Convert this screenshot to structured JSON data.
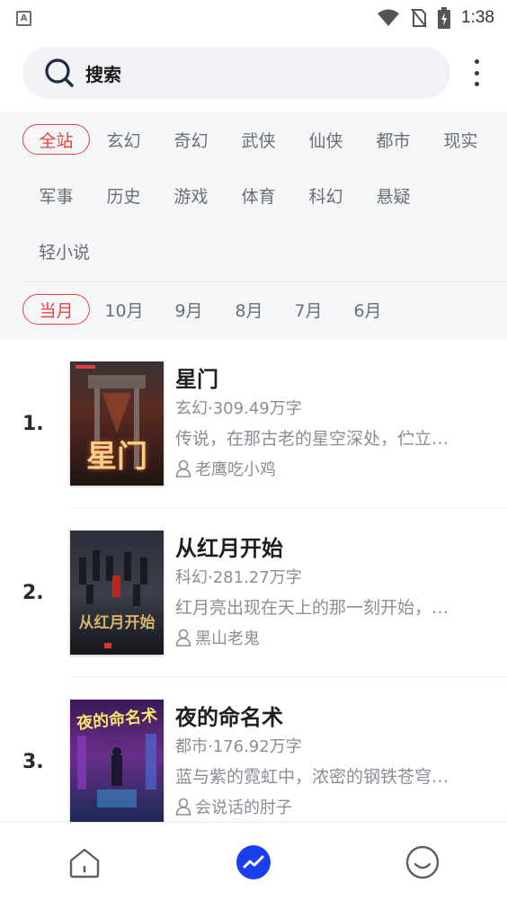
{
  "status_bar": {
    "left_icon": "A",
    "time": "1:38",
    "icons": [
      "wifi-icon",
      "no-sim-icon",
      "battery-charging-icon"
    ]
  },
  "search": {
    "label": "搜索",
    "icon": "search-icon"
  },
  "categories": [
    "全站",
    "玄幻",
    "奇幻",
    "武侠",
    "仙侠",
    "都市",
    "现实",
    "军事",
    "历史",
    "游戏",
    "体育",
    "科幻",
    "悬疑",
    "轻小说"
  ],
  "selected_category": "全站",
  "months": [
    "当月",
    "10月",
    "9月",
    "8月",
    "7月",
    "6月"
  ],
  "selected_month": "当月",
  "books": [
    {
      "rank": "1.",
      "title": "星门",
      "meta": "玄幻·309.49万字",
      "desc": "传说，在那古老的星空深处，伫立…",
      "author": "老鹰吃小鸡",
      "cover_title": "星门"
    },
    {
      "rank": "2.",
      "title": "从红月开始",
      "meta": "科幻·281.27万字",
      "desc": "红月亮出现在天上的那一刻开始，…",
      "author": "黑山老鬼",
      "cover_title": "从红月开始"
    },
    {
      "rank": "3.",
      "title": "夜的命名术",
      "meta": "都市·176.92万字",
      "desc": "蓝与紫的霓虹中，浓密的钢铁苍穹…",
      "author": "会说话的肘子",
      "cover_title": "夜的命名术"
    }
  ],
  "bottom_nav": [
    "home-icon",
    "trending-icon",
    "profile-icon"
  ],
  "colors": {
    "accent": "#e8423f",
    "nav_active": "#1b3ef0",
    "panel_bg": "#f5f6f8"
  }
}
